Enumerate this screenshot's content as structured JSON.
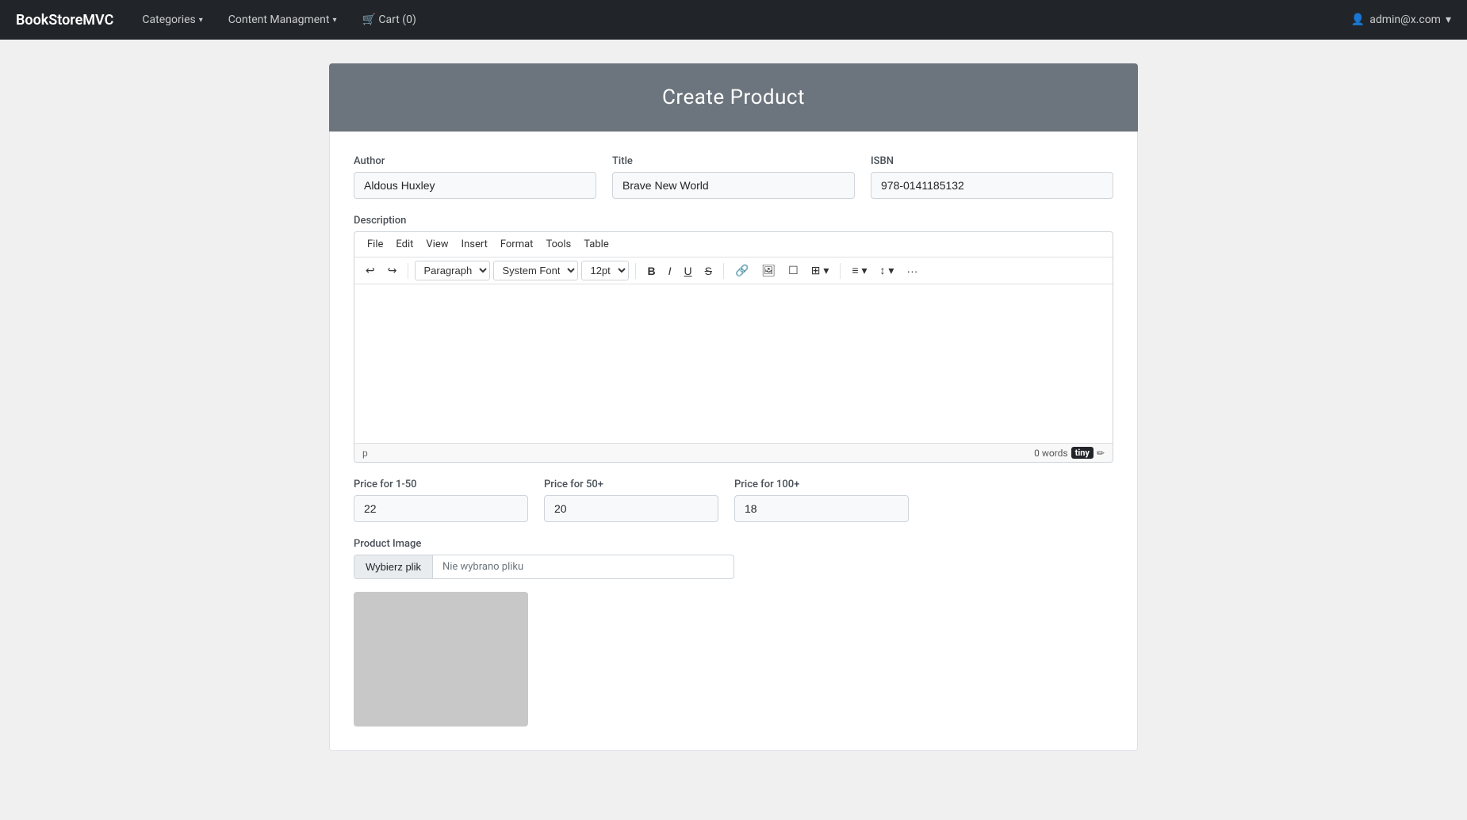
{
  "navbar": {
    "brand": "BookStoreMVC",
    "items": [
      {
        "label": "Categories",
        "has_dropdown": true
      },
      {
        "label": "Content Managment",
        "has_dropdown": true
      },
      {
        "label": "🛒 Cart (0)",
        "has_dropdown": false
      }
    ],
    "user": "admin@x.com",
    "user_icon": "👤"
  },
  "page": {
    "title": "Create Product"
  },
  "form": {
    "author_label": "Author",
    "author_value": "Aldous Huxley",
    "title_label": "Title",
    "title_value": "Brave New World",
    "isbn_label": "ISBN",
    "isbn_value": "978-0141185132",
    "description_label": "Description",
    "editor": {
      "menu_items": [
        "File",
        "Edit",
        "View",
        "Insert",
        "Format",
        "Tools",
        "Table"
      ],
      "paragraph_option": "Paragraph",
      "font_option": "System Font",
      "size_option": "12pt",
      "word_count": "0 words",
      "paragraph_indicator": "p"
    },
    "price_1_50_label": "Price for 1-50",
    "price_1_50_value": "22",
    "price_50_label": "Price for 50+",
    "price_50_value": "20",
    "price_100_label": "Price for 100+",
    "price_100_value": "18",
    "product_image_label": "Product Image",
    "file_choose_btn": "Wybierz plik",
    "file_name": "Nie wybrano pliku"
  }
}
